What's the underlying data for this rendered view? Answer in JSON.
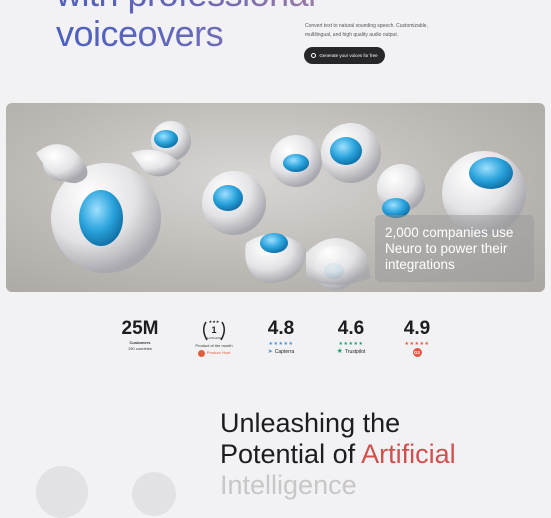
{
  "hero": {
    "title_line1": "with professional",
    "title_line2": "voiceovers",
    "description": "Convert text to natural sounding speech. Customizable, multilingual, and high quality audio output.",
    "cta_label": "Generate your voices for free"
  },
  "banner": {
    "caption": "2,000 companies use Neuro to power their integrations"
  },
  "stats": [
    {
      "value": "25M",
      "label": "Customers",
      "sublabel": "190 countries"
    },
    {
      "badge": "1st PLACE",
      "label": "Product of the month",
      "brand": "Product Hunt"
    },
    {
      "value": "4.8",
      "stars": "★★★★★",
      "brand": "Capterra"
    },
    {
      "value": "4.6",
      "stars": "★★★★★",
      "brand": "Trustpilot"
    },
    {
      "value": "4.9",
      "stars": "★★★★★",
      "brand": "G2"
    }
  ],
  "section": {
    "heading_line1": "Unleashing the",
    "heading_line2_a": "Potential of ",
    "heading_line2_b": "Artificial",
    "heading_line3": "Intelligence"
  },
  "colors": {
    "accent": "#d0504f",
    "dark": "#26262b",
    "capterra": "#4a90d9",
    "trustpilot": "#1aa36c",
    "g2": "#e8543d",
    "producthunt": "#e15e3a"
  }
}
